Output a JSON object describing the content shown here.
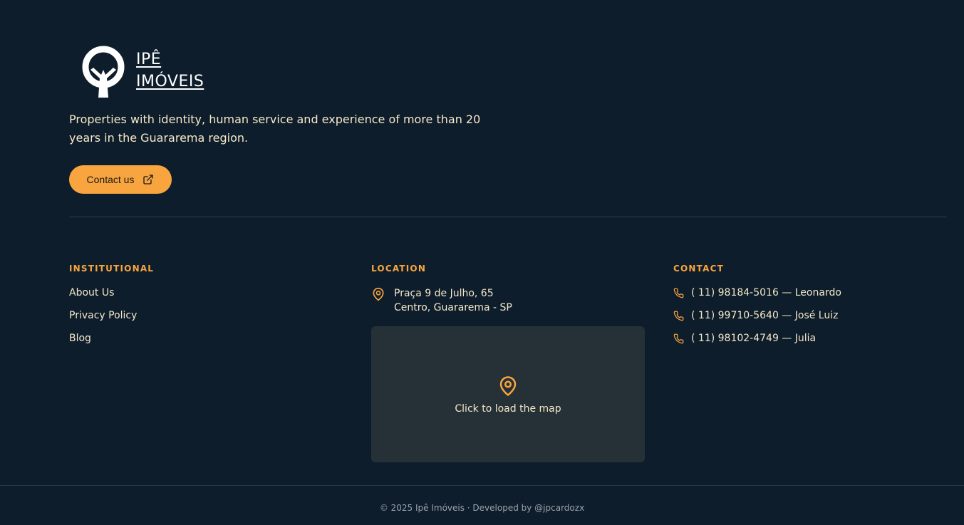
{
  "brand": {
    "name_line1": "IPÊ",
    "name_line2": "IMÓVEIS",
    "logo_icon": "tree-logo-icon"
  },
  "tagline": "Properties with identity, human service and experience of more than 20 years in the Guararema region.",
  "cta": {
    "label": "Contact us",
    "icon": "external-link-icon"
  },
  "institutional": {
    "title": "INSTITUTIONAL",
    "links": [
      "About Us",
      "Privacy Policy",
      "Blog"
    ]
  },
  "location": {
    "title": "LOCATION",
    "address_line1": "Praça 9 de Julho, 65",
    "address_line2": "Centro, Guararema - SP",
    "map_label": "Click to load the map"
  },
  "contact": {
    "title": "CONTACT",
    "phones": [
      "(  11) 98184-5016 — Leonardo",
      "(  11) 99710-5640 — José Luiz",
      "(  11) 98102-4749 — Julia"
    ]
  },
  "copyright": "© 2025 Ipê Imóveis · Developed by @jpcardozx",
  "colors": {
    "background": "#0e1d2b",
    "accent": "#f9a53f",
    "text": "#f3e7c9",
    "map_bg": "#263137"
  }
}
